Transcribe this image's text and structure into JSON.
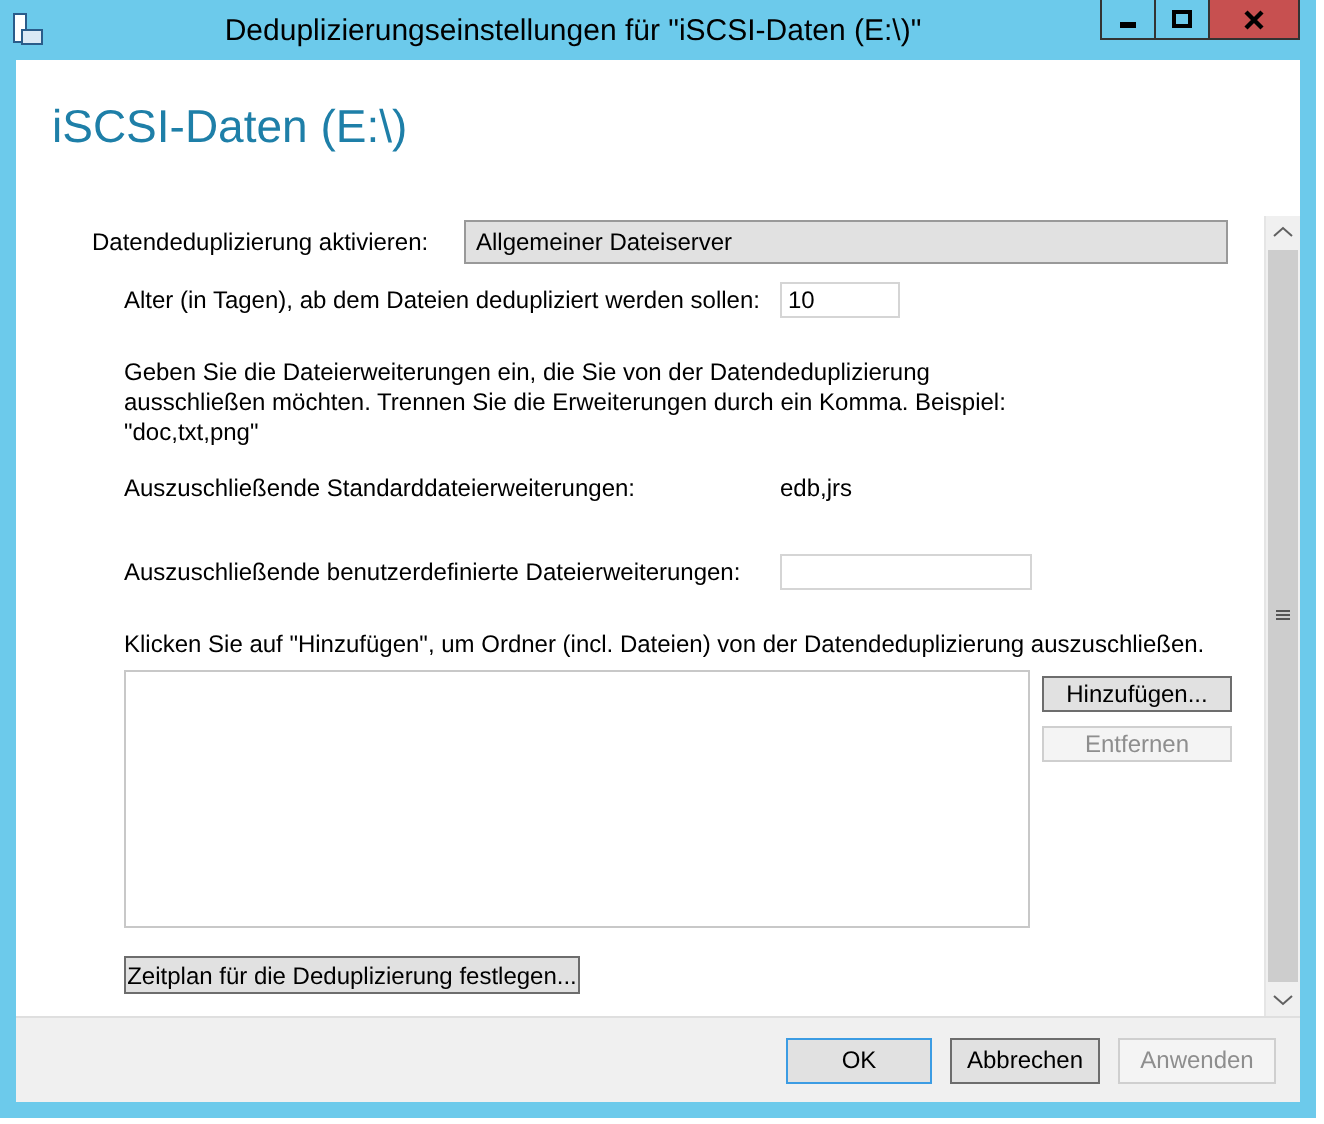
{
  "window": {
    "title": "Deduplizierungseinstellungen für \"iSCSI-Daten (E:\\)\""
  },
  "heading": "iSCSI-Daten (E:\\)",
  "dedup_mode": {
    "label": "Datendeduplizierung aktivieren:",
    "value": "Allgemeiner Dateiserver"
  },
  "age": {
    "label": "Alter (in Tagen), ab dem Dateien dedupliziert werden sollen:",
    "value": "10"
  },
  "instructions": "Geben Sie die Dateierweiterungen ein, die Sie von der Datendeduplizierung ausschließen möchten. Trennen Sie die Erweiterungen durch ein Komma. Beispiel: \"doc,txt,png\"",
  "default_extensions": {
    "label": "Auszuschließende Standarddateierweiterungen:",
    "value": "edb,jrs"
  },
  "custom_extensions": {
    "label": "Auszuschließende benutzerdefinierte Dateierweiterungen:"
  },
  "folders": {
    "label": "Klicken Sie auf \"Hinzufügen\", um Ordner (incl. Dateien) von der Datendeduplizierung auszuschließen.",
    "buttons": [
      {
        "label": "Hinzufügen...",
        "disabled": false
      },
      {
        "label": "Entfernen",
        "disabled": true
      }
    ]
  },
  "schedule_button": "Zeitplan für die Deduplizierung festlegen...",
  "footer_buttons": [
    {
      "label": "OK",
      "disabled": false,
      "default": true
    },
    {
      "label": "Abbrechen",
      "disabled": false,
      "default": false
    },
    {
      "label": "Anwenden",
      "disabled": true,
      "default": false
    }
  ]
}
